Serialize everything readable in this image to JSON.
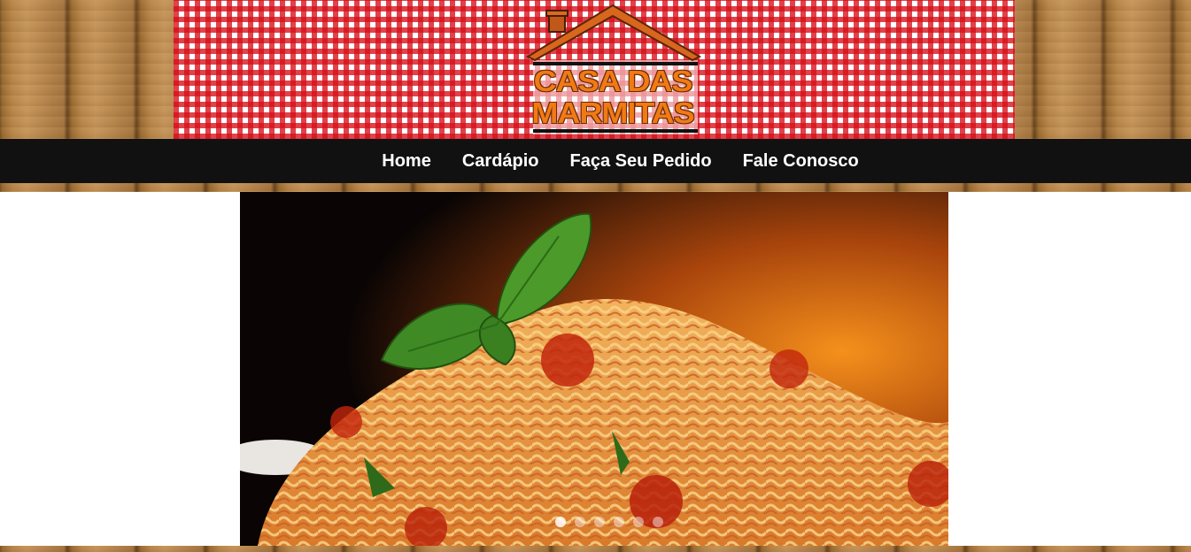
{
  "header": {
    "logo": {
      "line1": "CASA DAS",
      "line2": "MARMITAS"
    }
  },
  "nav": {
    "items": [
      {
        "label": "Home"
      },
      {
        "label": "Cardápio"
      },
      {
        "label": "Faça Seu Pedido"
      },
      {
        "label": "Fale Conosco"
      }
    ]
  },
  "slider": {
    "image": "spaghetti-with-tomato-sauce-and-basil",
    "slide_count": 6,
    "active_slide": 1
  },
  "colors": {
    "navbar": "#111111",
    "tablecloth_red": "#d60e18",
    "logo_orange": "#f07a14",
    "wood": "#b8864a"
  }
}
